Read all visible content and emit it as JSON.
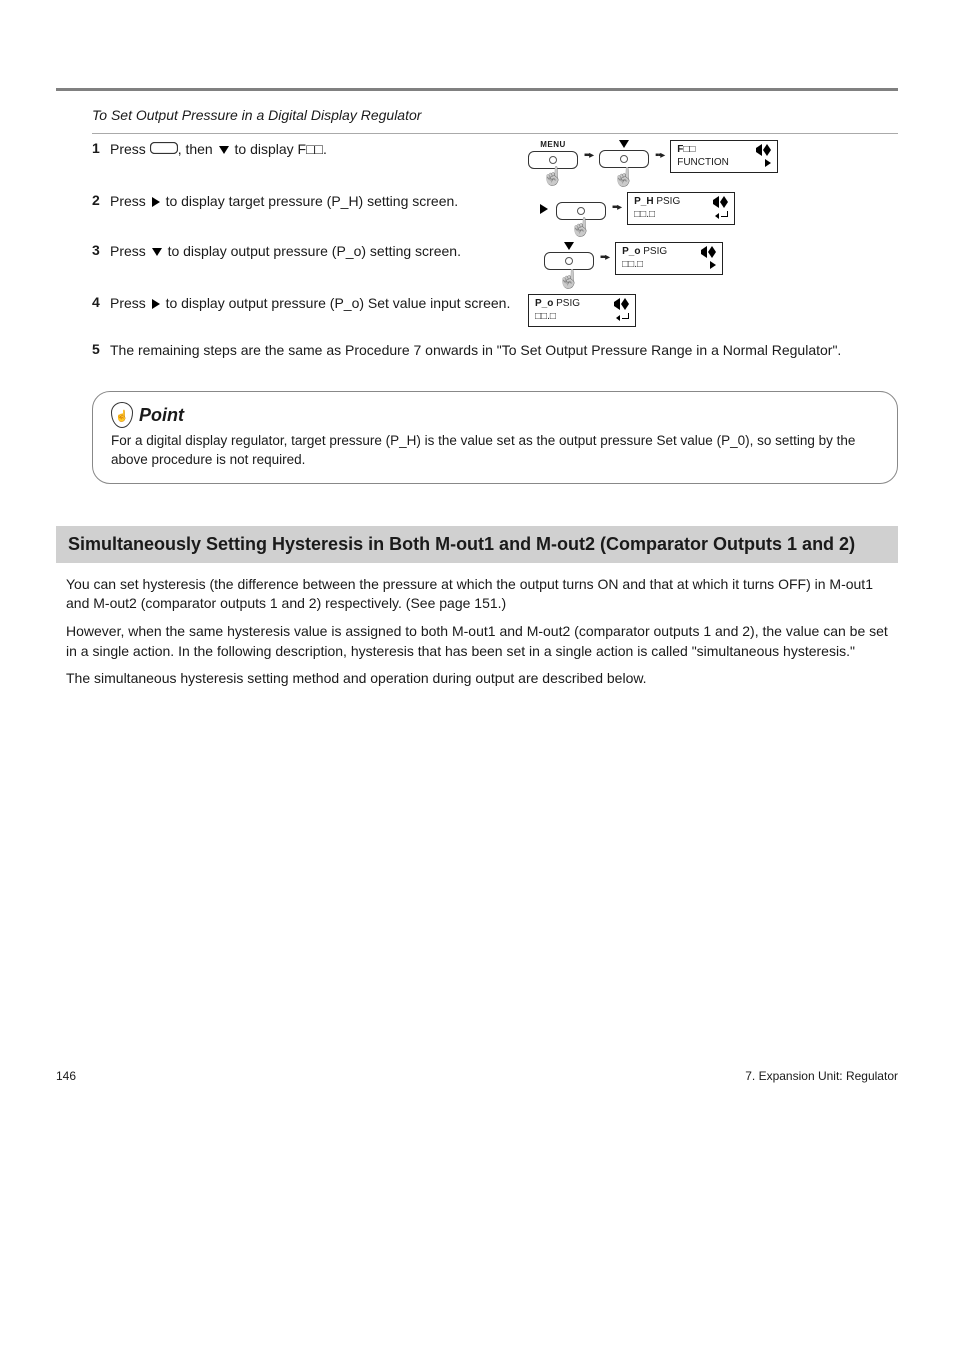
{
  "intro": "To Set Output Pressure in a Digital Display Regulator",
  "steps": {
    "s1": {
      "prefix": "Press ",
      "mid": ", then ",
      "tail": " to display F□□."
    },
    "s2": {
      "prefix": "Press ",
      "tail": " to display target pressure (P_H) setting screen."
    },
    "s3": {
      "prefix": "Press ",
      "tail": " to display output pressure (P_o) setting screen."
    },
    "s4": {
      "prefix": "Press ",
      "tail": " to display output pressure (P_o) Set value input screen."
    },
    "s5": "The remaining steps are the same as Procedure 7 onwards in \"To Set Output Pressure Range in a Normal Regulator\"."
  },
  "buttons": {
    "menu": "MENU"
  },
  "lcd": {
    "s1": {
      "row1": "F□□",
      "mark1": "◀⬍",
      "row2": "FUNCTION",
      "mark2": "▶"
    },
    "s2": {
      "row1": "P_H",
      "unit": "PSIG",
      "mark1": "◀⬍",
      "row2": "□□.□",
      "mark2": "↵"
    },
    "s3": {
      "row1": "P_o",
      "unit": "PSIG",
      "mark1": "◀⬍",
      "row2": "□□.□",
      "mark2": "▶"
    },
    "s4": {
      "row1": "P_o",
      "unit": "PSIG",
      "mark1": "◀⬍",
      "row2": "□□.□",
      "mark2": "↵"
    }
  },
  "point": {
    "label": "Point",
    "body": "For a digital display regulator, target pressure (P_H) is the value set as the output pressure Set value (P_0), so setting by the above procedure is not required."
  },
  "section": {
    "title": "Simultaneously Setting Hysteresis in Both M-out1 and M-out2 (Comparator Outputs 1 and 2)",
    "para1": "You can set hysteresis (the difference between the pressure at which the output turns ON and that at which it turns OFF) in M-out1 and M-out2 (comparator outputs 1 and 2) respectively. (See page 151.)",
    "para2": "However, when the same hysteresis value is assigned to both M-out1 and M-out2 (comparator outputs 1 and 2), the value can be set in a single action. In the following description, hysteresis that has been set in a single action is called \"simultaneous hysteresis.\"",
    "para3": "The simultaneous hysteresis setting method and operation during output are described below."
  },
  "footer": {
    "left": "146",
    "right": "7. Expansion Unit: Regulator"
  }
}
